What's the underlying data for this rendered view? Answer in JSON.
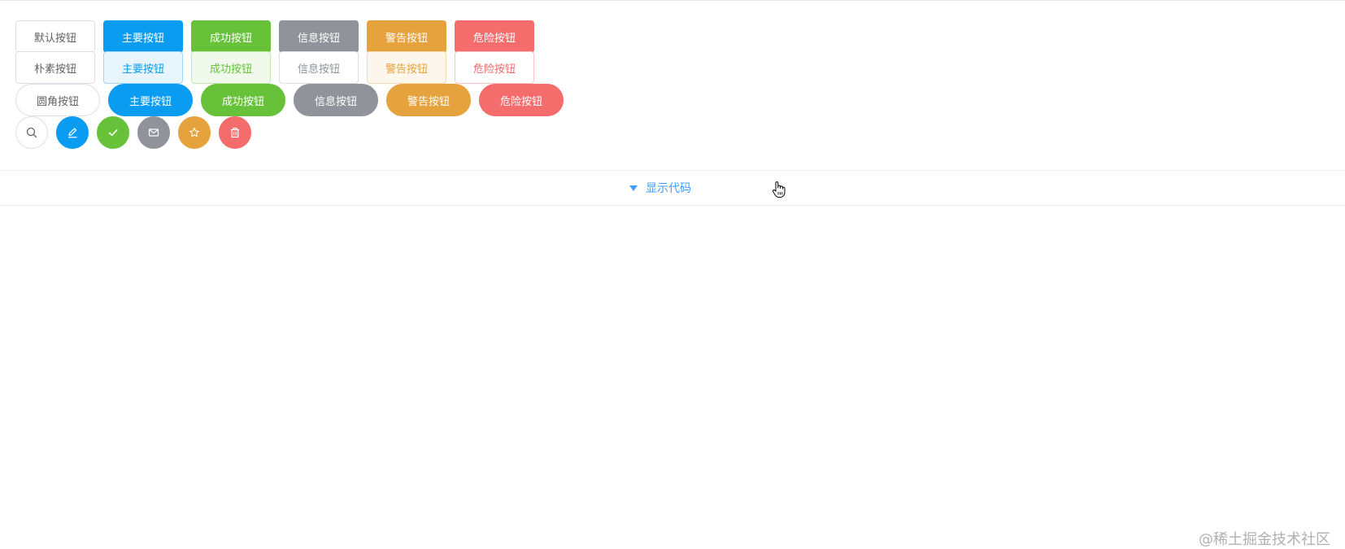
{
  "rows": {
    "default": [
      "默认按钮",
      "主要按钮",
      "成功按钮",
      "信息按钮",
      "警告按钮",
      "危险按钮"
    ],
    "plain": [
      "朴素按钮",
      "主要按钮",
      "成功按钮",
      "信息按钮",
      "警告按钮",
      "危险按钮"
    ],
    "round": [
      "圆角按钮",
      "主要按钮",
      "成功按钮",
      "信息按钮",
      "警告按钮",
      "危险按钮"
    ]
  },
  "circle_icons": [
    "search-icon",
    "edit-icon",
    "check-icon",
    "mail-icon",
    "star-icon",
    "delete-icon"
  ],
  "code_toggle": {
    "label": "显示代码"
  },
  "watermark": "@稀土掘金技术社区",
  "colors": {
    "primary": "#0a9cf0",
    "success": "#67c23a",
    "info": "#909399",
    "warning": "#e6a23c",
    "danger": "#f56c6c",
    "link": "#409eff"
  }
}
